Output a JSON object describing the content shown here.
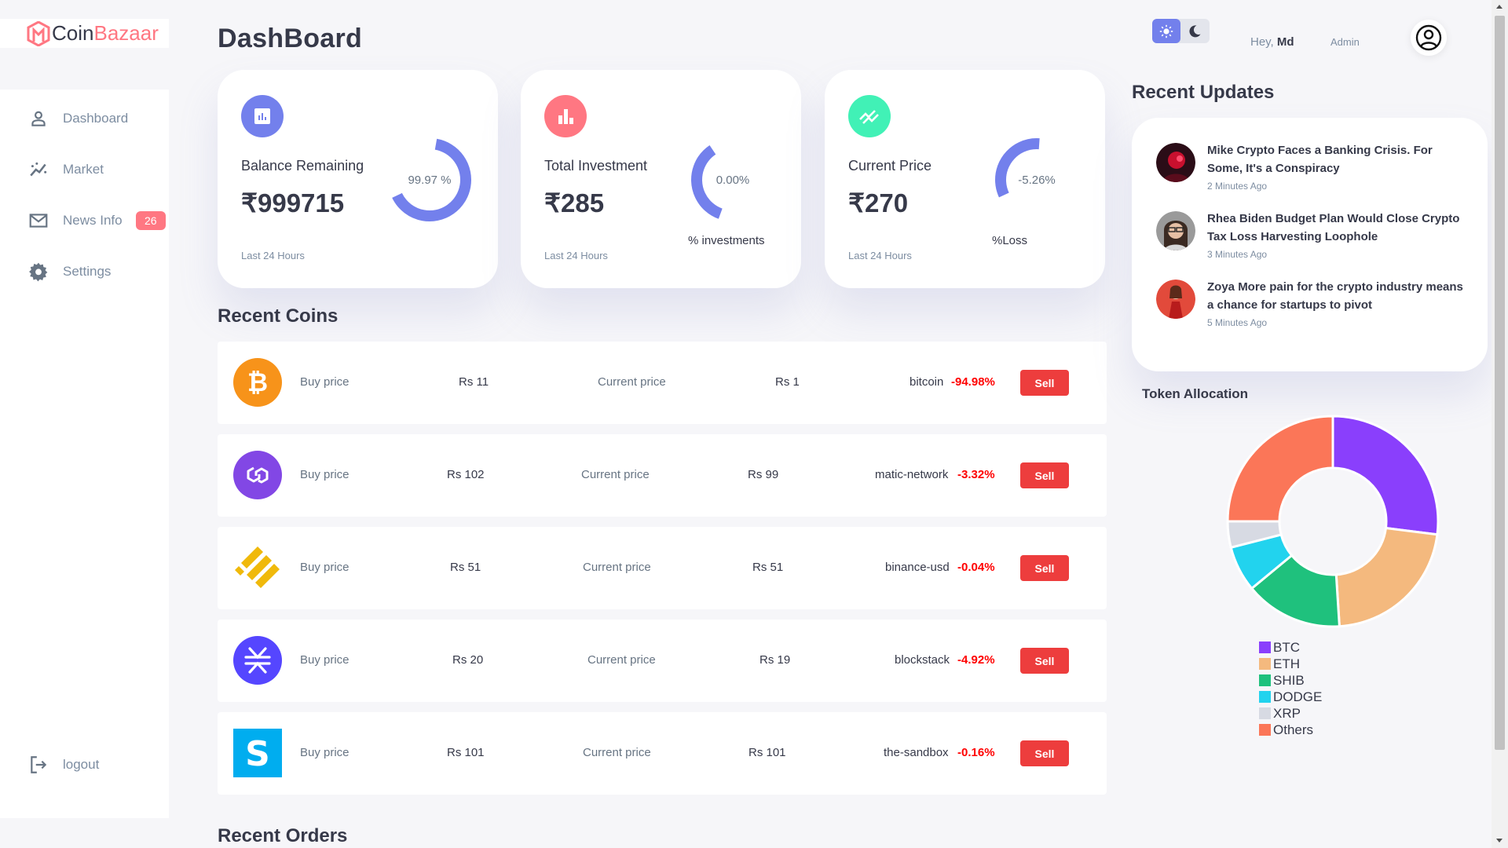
{
  "brand": {
    "part1": "Coin",
    "part2": "Bazaar",
    "accent": "#ff7782"
  },
  "sidebar": {
    "items": [
      {
        "label": "Dashboard",
        "icon": "person-icon"
      },
      {
        "label": "Market",
        "icon": "chart-line-icon"
      },
      {
        "label": "News Info",
        "icon": "mail-icon",
        "badge": "26"
      },
      {
        "label": "Settings",
        "icon": "gear-icon"
      }
    ],
    "logout": {
      "label": "logout",
      "icon": "logout-icon"
    }
  },
  "header": {
    "title": "DashBoard",
    "greeting": "Hey,",
    "username": "Md",
    "role": "Admin",
    "theme": {
      "active": "light"
    }
  },
  "insights": [
    {
      "icon": "chart-icon",
      "icon_color": "#7380ec",
      "label": "Balance Remaining",
      "value": "₹999715",
      "foot": "Last 24 Hours",
      "ring_text": "99.97 %",
      "ring_fraction": 0.9997,
      "under": ""
    },
    {
      "icon": "bar-chart-icon",
      "icon_color": "#ff7782",
      "label": "Total Investment",
      "value": "₹285",
      "foot": "Last 24 Hours",
      "ring_text": "0.00%",
      "ring_fraction": 0.0,
      "under": "% investments"
    },
    {
      "icon": "trend-icon",
      "icon_color": "#41f1b6",
      "label": "Current Price",
      "value": "₹270",
      "foot": "Last 24 Hours",
      "ring_text": "-5.26%",
      "ring_fraction": 0.0526,
      "under": "%Loss"
    }
  ],
  "recent_coins": {
    "title": "Recent Coins",
    "buy_label": "Buy price",
    "current_label": "Current price",
    "sell_label": "Sell",
    "rows": [
      {
        "icon": "bitcoin-icon",
        "buy": "Rs 11",
        "current": "Rs 1",
        "name": "bitcoin",
        "change": "-94.98%"
      },
      {
        "icon": "polygon-icon",
        "buy": "Rs 102",
        "current": "Rs 99",
        "name": "matic-network",
        "change": "-3.32%"
      },
      {
        "icon": "binance-usd-icon",
        "buy": "Rs 51",
        "current": "Rs 51",
        "name": "binance-usd",
        "change": "-0.04%"
      },
      {
        "icon": "stacks-icon",
        "buy": "Rs 20",
        "current": "Rs 19",
        "name": "blockstack",
        "change": "-4.92%"
      },
      {
        "icon": "sandbox-icon",
        "buy": "Rs 101",
        "current": "Rs 101",
        "name": "the-sandbox",
        "change": "-0.16%"
      }
    ]
  },
  "recent_orders": {
    "title": "Recent Orders"
  },
  "recent_updates": {
    "title": "Recent Updates",
    "items": [
      {
        "name": "Mike",
        "text": "Crypto Faces a Banking Crisis. For Some, It's a Conspiracy",
        "time": "2 Minutes Ago"
      },
      {
        "name": "Rhea",
        "text": "Biden Budget Plan Would Close Crypto Tax Loss Harvesting Loophole",
        "time": "3 Minutes Ago"
      },
      {
        "name": "Zoya",
        "text": "More pain for the crypto industry means a chance for startups to pivot",
        "time": "5 Minutes Ago"
      }
    ]
  },
  "token_allocation": {
    "title": "Token Allocation",
    "chart_data": {
      "type": "pie",
      "categories": [
        "BTC",
        "ETH",
        "SHIB",
        "DODGE",
        "XRP",
        "Others"
      ],
      "values": [
        27,
        22,
        15,
        7,
        4,
        25
      ],
      "colors": [
        "#8a3ffc",
        "#f4b97e",
        "#1fc17d",
        "#22d3ee",
        "#d7dae3",
        "#fb7658"
      ],
      "legend": "bottom",
      "title": "Token Allocation"
    }
  }
}
